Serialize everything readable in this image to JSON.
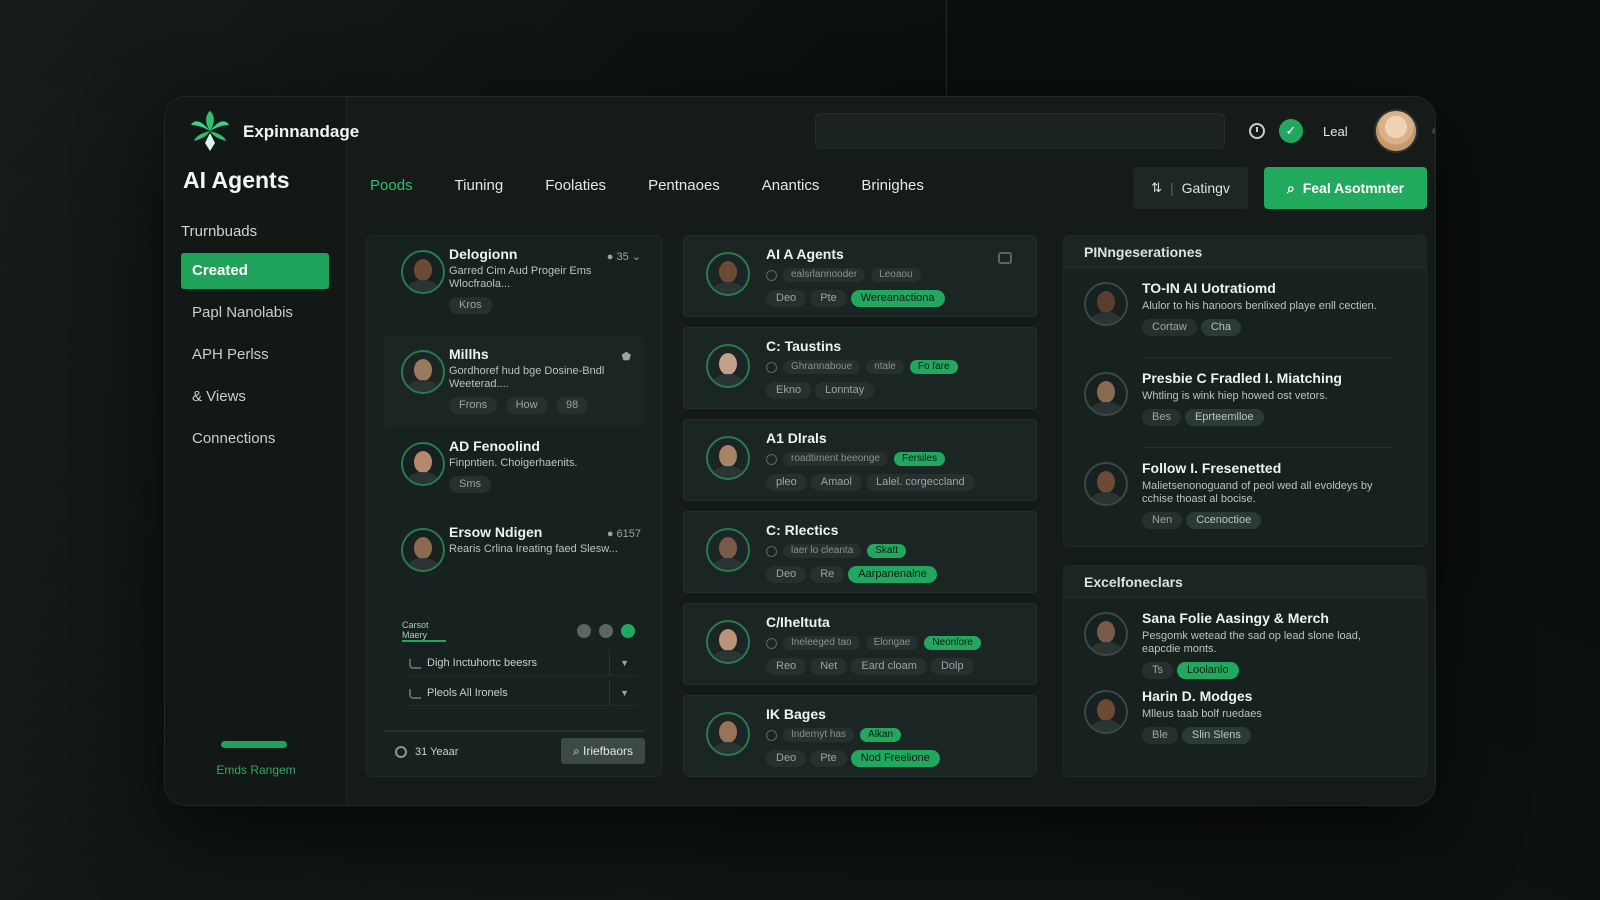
{
  "app": {
    "name": "Expinnandage"
  },
  "header": {
    "user_name": "Leal",
    "secondary_button": "Gatingv",
    "primary_button": "Feal Asotmnter"
  },
  "sidebar": {
    "title": "AI Agents",
    "section": "Trurnbuads",
    "items": [
      {
        "label": "Created"
      },
      {
        "label": "Papl Nanolabis"
      },
      {
        "label": "APH Perlss"
      },
      {
        "label": "& Views"
      },
      {
        "label": "Connections"
      }
    ],
    "footer": "Emds Rangem"
  },
  "tabs": [
    {
      "label": "Poods"
    },
    {
      "label": "Tiuning"
    },
    {
      "label": "Foolaties"
    },
    {
      "label": "Pentnaoes"
    },
    {
      "label": "Anantics"
    },
    {
      "label": "Brinighes"
    }
  ],
  "people": [
    {
      "name": "Delogionn",
      "desc": "Garred Cim Aud Progeir Ems Wlocfraola...",
      "tag": "Kros",
      "meta": "35"
    },
    {
      "name": "Millhs",
      "desc": "Gordhoref hud bge Dosine-Bndl Weeterad....",
      "tags": [
        "Frons",
        "How",
        "98"
      ]
    },
    {
      "name": "AD Fenoolind",
      "desc": "Finpntien. Choigerhaenits.",
      "tag": "Sms"
    },
    {
      "name": "Ersow Ndigen",
      "desc": "Rearis Crlina Ireating faed Slesw...",
      "tag": "",
      "meta": "6157"
    }
  ],
  "col1_footer": {
    "mini_tag": "Carsot Maery",
    "filters": [
      "Digh Inctuhortc beesrs",
      "Pleols All Ironels"
    ],
    "radio_label": "31 Yeaar",
    "button": "Iriefbaors"
  },
  "agents": [
    {
      "name": "AI A Agents",
      "sub": [
        "ealsrlannooder",
        "Leoaou"
      ],
      "pills": [
        "Deo",
        "Pte"
      ],
      "green_pill": "Wereanactiona"
    },
    {
      "name": "C: Taustins",
      "sub": [
        "Ghrannaboue",
        "ntale"
      ],
      "sub_green": "Fo fare",
      "pills": [
        "Ekno",
        "Lonntay"
      ]
    },
    {
      "name": "A1 Dlrals",
      "sub": [
        "roadtiment beeonge"
      ],
      "sub_green": "Fersiles",
      "pills": [
        "pleo",
        "Amaol",
        "Lalel. corgeccland"
      ]
    },
    {
      "name": "C: Rlectics",
      "sub": [
        "laer lo cleanta"
      ],
      "sub_green": "Skatt",
      "pills": [
        "Deo",
        "Re"
      ],
      "green_pill": "Aarpanenalne"
    },
    {
      "name": "C/Iheltuta",
      "sub": [
        "Ineleeged tao",
        "Elongae"
      ],
      "sub_green": "Neonlore",
      "pills": [
        "Reo",
        "Net",
        "Eard cloam",
        "Dolp"
      ]
    },
    {
      "name": "IK Bages",
      "sub": [
        "Indernyt has"
      ],
      "sub_green": "Alkan",
      "pills": [
        "Deo",
        "Pte"
      ],
      "green_pill": "Nod Freelione"
    }
  ],
  "right_section_1": {
    "title": "PINngeserationes",
    "items": [
      {
        "name": "TO-IN AI Uotratiomd",
        "desc": "Alulor to his hanoors benlixed playe enll cectien.",
        "tag": "Cortaw",
        "chip": "Cha"
      },
      {
        "name": "Presbie C Fradled I. Miatching",
        "desc": "Whtling is wink hiep howed ost vetors.",
        "tag": "Bes",
        "chip": "Eprteemlloe"
      },
      {
        "name": "Follow I. Fresenetted",
        "desc": "Malietsenonoguand of peol wed all evoldeys by cchise thoast al bocise.",
        "tag": "Nen",
        "chip": "Ccenoctioe"
      }
    ]
  },
  "right_section_2": {
    "title": "Excelfoneclars",
    "items": [
      {
        "name": "Sana Folie Aasingy & Merch",
        "desc": "Pesgomk wetead the sad op lead slone load, eapcdie monts.",
        "tag": "Ts",
        "chip": "Loolanlo"
      },
      {
        "name": "Harin D. Modges",
        "desc": "Mlleus taab bolf ruedaes",
        "tag": "Ble",
        "chip": "Slin Slens"
      }
    ]
  },
  "colors": {
    "accent": "#21a95d",
    "background": "#0b0f0e",
    "panel": "#172120"
  }
}
